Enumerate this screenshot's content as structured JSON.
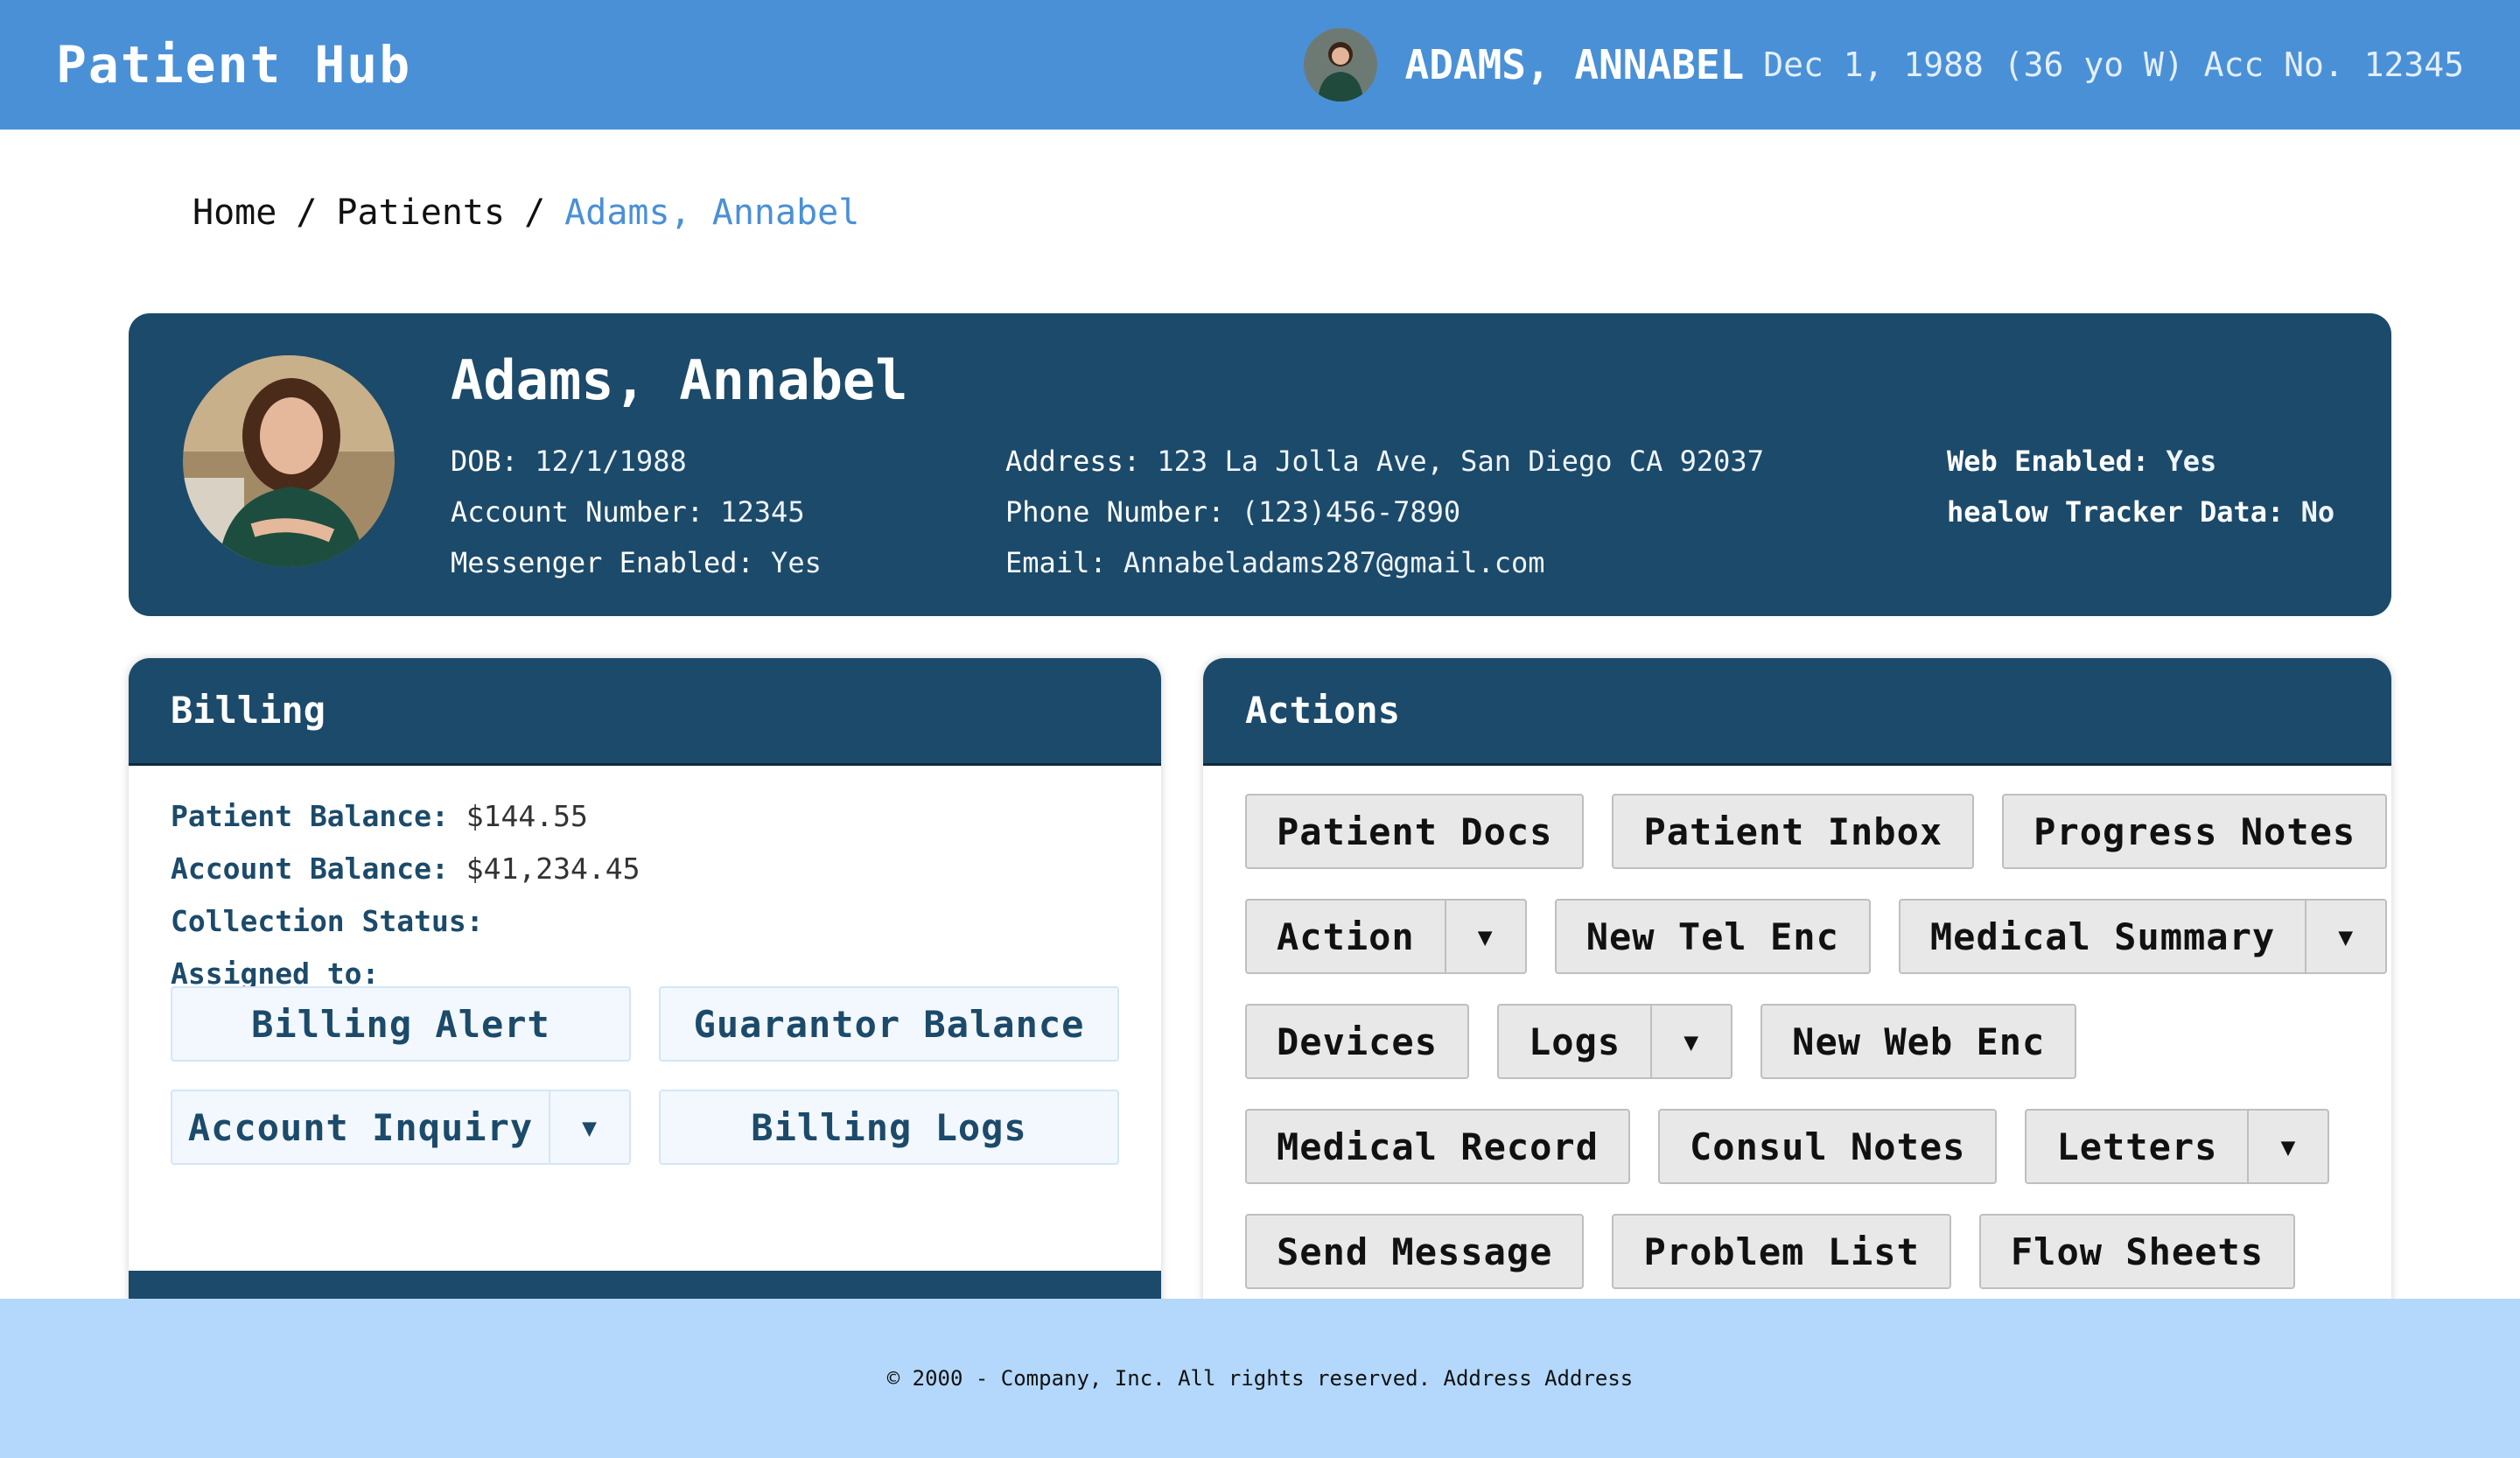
{
  "app": {
    "title": "Patient Hub"
  },
  "header": {
    "patient_name": "ADAMS, ANNABEL",
    "patient_meta": "Dec 1, 1988 (36 yo W) Acc No. 12345"
  },
  "breadcrumb": {
    "items": [
      "Home",
      "Patients"
    ],
    "separator": "/",
    "current": "Adams, Annabel"
  },
  "patient": {
    "name": "Adams, Annabel",
    "col1": [
      {
        "label": "DOB:",
        "value": "12/1/1988"
      },
      {
        "label": "Account Number:",
        "value": "12345"
      },
      {
        "label": "Messenger Enabled:",
        "value": "Yes"
      }
    ],
    "col2": [
      {
        "label": "Address:",
        "value": "123 La Jolla Ave, San Diego CA 92037"
      },
      {
        "label": "Phone Number:",
        "value": "(123)456-7890"
      },
      {
        "label": "Email:",
        "value": "Annabeladams287@gmail.com"
      }
    ],
    "col3": [
      {
        "label": "Web Enabled:",
        "value": "Yes"
      },
      {
        "label": "healow Tracker Data:",
        "value": "No"
      }
    ]
  },
  "billing": {
    "title": "Billing",
    "patient_balance_label": "Patient Balance:",
    "patient_balance": "$144.55",
    "account_balance_label": "Account Balance:",
    "account_balance": "$41,234.45",
    "collection_status_label": "Collection Status:",
    "collection_status": "",
    "assigned_to_label": "Assigned to:",
    "assigned_to": "",
    "buttons": {
      "billing_alert": "Billing Alert",
      "guarantor_balance": "Guarantor Balance",
      "account_inquiry": "Account Inquiry",
      "billing_logs": "Billing Logs"
    }
  },
  "actions": {
    "title": "Actions",
    "caret": "▼",
    "buttons": {
      "patient_docs": "Patient Docs",
      "patient_inbox": "Patient Inbox",
      "progress_notes": "Progress Notes",
      "action": "Action",
      "new_tel_enc": "New Tel Enc",
      "medical_summary": "Medical Summary",
      "devices": "Devices",
      "logs": "Logs",
      "new_web_enc": "New Web Enc",
      "medical_record": "Medical Record",
      "consul_notes": "Consul Notes",
      "letters": "Letters",
      "send_message": "Send Message",
      "problem_list": "Problem List",
      "flow_sheets": "Flow Sheets"
    }
  },
  "footer": {
    "text": "© 2000 - Company, Inc. All rights reserved. Address Address"
  },
  "colors": {
    "header": "#4a90d6",
    "banner": "#1c4a6a",
    "footer": "#b3d8fb",
    "link": "#4a90d6"
  }
}
